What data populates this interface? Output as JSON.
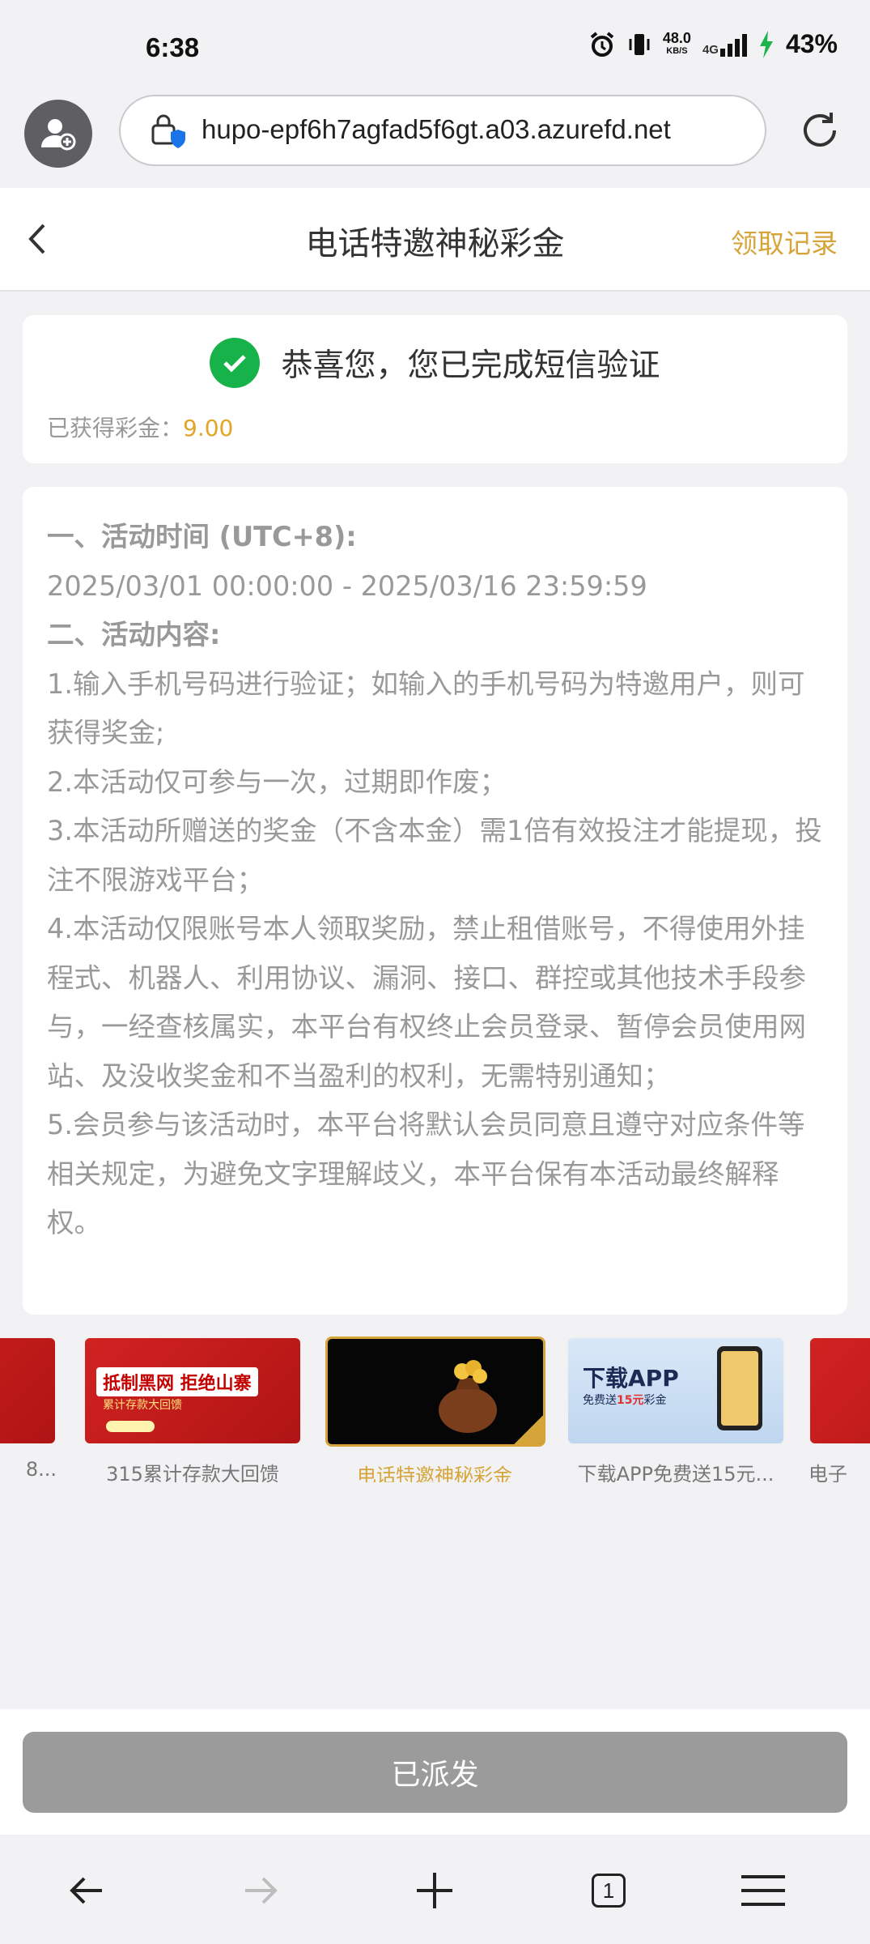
{
  "status": {
    "time": "6:38",
    "net_speed": "48.0",
    "net_unit": "KB/S",
    "network_type": "4G",
    "battery": "43%"
  },
  "browser": {
    "url": "hupo-epf6h7agfad5f6gt.a03.azurefd.net",
    "tab_count": "1"
  },
  "header": {
    "title": "电话特邀神秘彩金",
    "records_link": "领取记录"
  },
  "success": {
    "message": "恭喜您，您已完成短信验证",
    "earned_label": "已获得彩金：",
    "earned_amount": "9.00"
  },
  "rules": {
    "time_heading": "一、活动时间 (UTC+8):",
    "time_range": "2025/03/01 00:00:00 - 2025/03/16 23:59:59",
    "content_heading": "二、活动内容:",
    "items": [
      "1.输入手机号码进行验证；如输入的手机号码为特邀用户，则可获得奖金;",
      "2.本活动仅可参与一次，过期即作废；",
      "3.本活动所赠送的奖金（不含本金）需1倍有效投注才能提现，投注不限游戏平台；",
      "4.本活动仅限账号本人领取奖励，禁止租借账号，不得使用外挂程式、机器人、利用协议、漏洞、接口、群控或其他技术手段参与，一经查核属实，本平台有权终止会员登录、暂停会员使用网站、及没收奖金和不当盈利的权利，无需特别通知；",
      "5.会员参与该活动时，本平台将默认会员同意且遵守对应条件等相关规定，为避免文字理解歧义，本平台保有本活动最终解释权。"
    ]
  },
  "banners": [
    {
      "caption": "8...",
      "active": false
    },
    {
      "caption": "315累计存款大回馈",
      "active": false,
      "art_title": "抵制黑网 拒绝山寨",
      "art_sub": "累计存款大回馈"
    },
    {
      "caption": "电话特邀神秘彩金",
      "active": true
    },
    {
      "caption": "下载APP免费送15元...",
      "active": false,
      "art_title": "下载APP",
      "art_sub_pre": "免费送",
      "art_sub_amount": "15元",
      "art_sub_post": "彩金"
    },
    {
      "caption": "电子",
      "active": false
    }
  ],
  "footer": {
    "button_label": "已派发"
  },
  "colors": {
    "accent_gold": "#d6a53a",
    "amount_gold": "#e2a526",
    "success_green": "#17b34a",
    "disabled_button": "#9b9b9b"
  },
  "icons": [
    "alarm-icon",
    "vibrate-icon",
    "signal-icon",
    "battery-charging-icon",
    "user-add-icon",
    "lock-shield-icon",
    "reload-icon",
    "back-chevron-icon",
    "check-circle-icon",
    "nav-back-icon",
    "nav-forward-icon",
    "new-tab-icon",
    "tabs-icon",
    "menu-icon"
  ]
}
